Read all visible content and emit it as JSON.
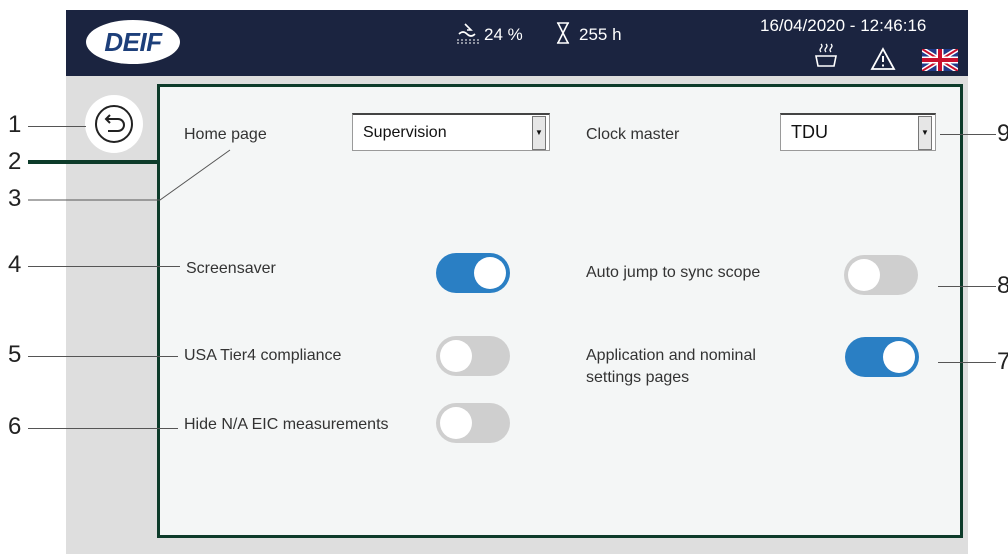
{
  "header": {
    "logo_text": "DEIF",
    "fuel_level": "24 %",
    "run_hours": "255 h",
    "datetime": "16/04/2020 - 12:46:16",
    "icons": [
      "fuel-icon",
      "hourglass-icon",
      "heater-icon",
      "warning-icon",
      "uk-flag-icon"
    ]
  },
  "settings": {
    "home_page": {
      "label": "Home page",
      "value": "Supervision"
    },
    "clock_master": {
      "label": "Clock master",
      "value": "TDU"
    },
    "screensaver": {
      "label": "Screensaver",
      "on": true
    },
    "auto_jump": {
      "label": "Auto jump to sync scope",
      "on": false
    },
    "usa_tier4": {
      "label": "USA Tier4 compliance",
      "on": false
    },
    "app_nominal": {
      "label_line1": "Application and nominal",
      "label_line2": "settings pages",
      "on": true
    },
    "hide_na": {
      "label": "Hide N/A EIC measurements",
      "on": false
    }
  },
  "callouts": [
    "1",
    "2",
    "3",
    "4",
    "5",
    "6",
    "7",
    "8",
    "9"
  ],
  "colors": {
    "header_bg": "#1b2440",
    "toggle_on": "#2a7fc4",
    "toggle_off": "#cfcfcf",
    "panel_border": "#0d3b2a"
  }
}
